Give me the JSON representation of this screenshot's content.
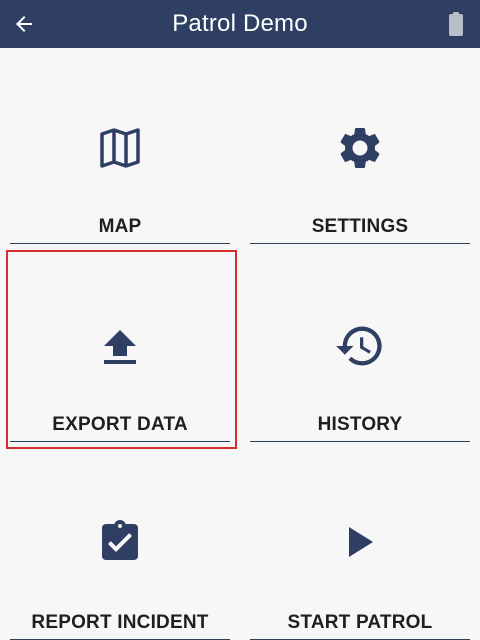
{
  "header": {
    "title": "Patrol Demo",
    "back_icon": "arrow-left-icon",
    "battery_icon": "battery-icon"
  },
  "menu": {
    "tiles": [
      {
        "label": "MAP",
        "icon": "map-icon"
      },
      {
        "label": "SETTINGS",
        "icon": "gear-icon"
      },
      {
        "label": "EXPORT DATA",
        "icon": "upload-icon"
      },
      {
        "label": "HISTORY",
        "icon": "history-icon"
      },
      {
        "label": "REPORT INCIDENT",
        "icon": "clipboard-check-icon"
      },
      {
        "label": "START PATROL",
        "icon": "play-icon"
      }
    ]
  },
  "colors": {
    "header_bg": "#2e3f63",
    "icon": "#2e3f63",
    "background": "#f7f7f7",
    "highlight": "#d32f2f"
  }
}
